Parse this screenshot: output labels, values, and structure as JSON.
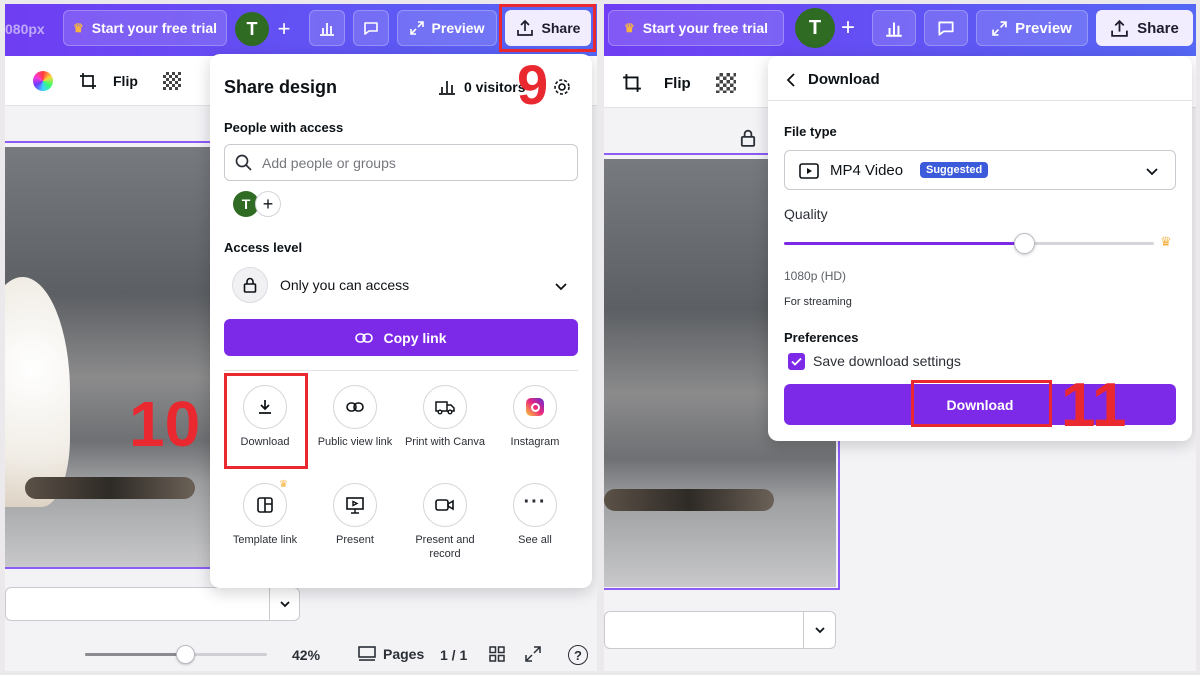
{
  "left": {
    "top_bar": {
      "size_label": "080px",
      "trial_label": "Start your free trial",
      "avatar_initial": "T",
      "preview_label": "Preview",
      "share_label": "Share"
    },
    "toolbar": {
      "flip_label": "Flip"
    },
    "share_panel": {
      "title": "Share design",
      "visitors": "0 visitors",
      "people_heading": "People with access",
      "add_placeholder": "Add people or groups",
      "avatar_initial": "T",
      "access_heading": "Access level",
      "access_value": "Only you can access",
      "copy_link_label": "Copy link",
      "options": [
        {
          "label": "Download",
          "icon": "download-icon"
        },
        {
          "label": "Public view link",
          "icon": "link-icon"
        },
        {
          "label": "Print with Canva",
          "icon": "truck-icon"
        },
        {
          "label": "Instagram",
          "icon": "instagram-icon"
        },
        {
          "label": "Template link",
          "icon": "template-icon"
        },
        {
          "label": "Present",
          "icon": "present-icon"
        },
        {
          "label": "Present and record",
          "icon": "camera-icon"
        },
        {
          "label": "See all",
          "icon": "more-icon"
        }
      ]
    },
    "bottom_bar": {
      "zoom": "42%",
      "pages_label": "Pages",
      "page_count": "1 / 1",
      "zoom_level": 0.55
    },
    "steps": {
      "share": "9",
      "download": "10"
    }
  },
  "right": {
    "top_bar": {
      "trial_label": "Start your free trial",
      "avatar_initial": "T",
      "preview_label": "Preview",
      "share_label": "Share"
    },
    "toolbar": {
      "flip_label": "Flip"
    },
    "download_panel": {
      "title": "Download",
      "file_type_heading": "File type",
      "file_type_value": "MP4 Video",
      "suggested_badge": "Suggested",
      "quality_heading": "Quality",
      "quality_level": 0.65,
      "quality_value": "1080p (HD)",
      "quality_note": "For streaming",
      "preferences_heading": "Preferences",
      "save_settings_label": "Save download settings",
      "save_settings_checked": true,
      "download_button_label": "Download"
    },
    "steps": {
      "download_button": "11"
    }
  },
  "colors": {
    "brand_purple": "#7d2ae8",
    "annotation_red": "#e9292f",
    "topbar_start": "#6f3df3",
    "topbar_end": "#5567f4"
  }
}
